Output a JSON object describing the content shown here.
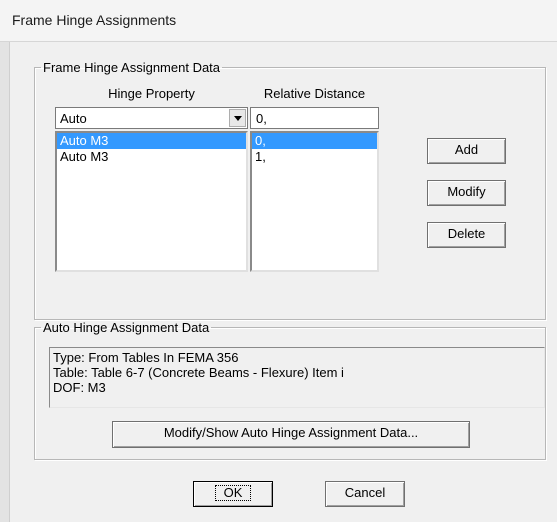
{
  "window": {
    "title": "Frame Hinge Assignments"
  },
  "hinge_group": {
    "legend": "Frame Hinge Assignment Data",
    "columns": {
      "hinge_property": "Hinge Property",
      "relative_distance": "Relative Distance"
    },
    "hinge_property_select": {
      "value": "Auto"
    },
    "relative_distance_input": {
      "value": "0,"
    },
    "hinge_list": [
      {
        "property": "Auto  M3",
        "distance": "0,",
        "selected": true
      },
      {
        "property": "Auto  M3",
        "distance": "1,",
        "selected": false
      }
    ],
    "buttons": {
      "add": "Add",
      "modify": "Modify",
      "delete": "Delete"
    }
  },
  "auto_group": {
    "legend": "Auto Hinge Assignment Data",
    "lines": [
      "Type:  From Tables In FEMA 356",
      "Table:  Table 6-7 (Concrete Beams - Flexure) Item i",
      "DOF:  M3"
    ],
    "modify_show_button": "Modify/Show Auto Hinge Assignment Data..."
  },
  "footer": {
    "ok": "OK",
    "cancel": "Cancel"
  },
  "colors": {
    "selection": "#3399ff",
    "dialog_bg": "#f0f0f0"
  }
}
